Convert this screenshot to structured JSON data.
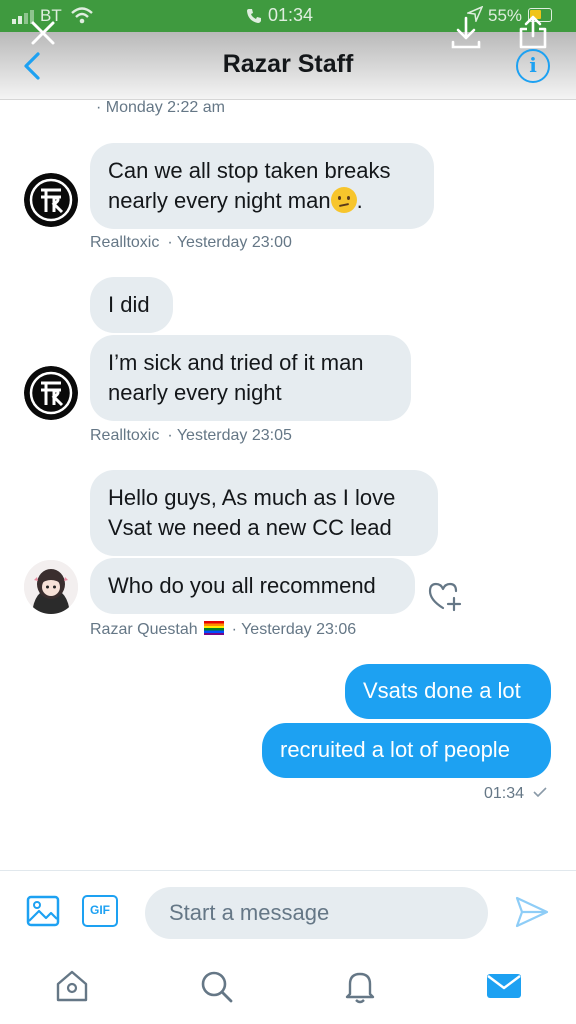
{
  "status_bar": {
    "carrier": "BT",
    "time": "01:34",
    "battery": "55%"
  },
  "header": {
    "title": "Razar Staff"
  },
  "top_timestamp": "· Monday 2:22 am",
  "messages": [
    {
      "sender": "Realltoxic",
      "time": "· Yesterday 23:00",
      "bubbles": [
        "Can we all stop taken breaks nearly every night man",
        "."
      ]
    },
    {
      "sender": "Realltoxic",
      "time": "· Yesterday 23:05",
      "bubbles": [
        "I did",
        "I’m sick and tried of it man nearly every night"
      ]
    },
    {
      "sender": "Razar Questah",
      "time": "· Yesterday 23:06",
      "bubbles": [
        "Hello guys, As much as I love Vsat we need a new CC lead",
        "Who do you all recommend"
      ]
    },
    {
      "sender": "me",
      "time": "01:34",
      "bubbles": [
        "Vsats done a lot",
        "recruited a lot of people"
      ]
    }
  ],
  "composer": {
    "placeholder": "Start a message",
    "gif_label": "GIF"
  },
  "icons": {
    "back": "chevron-left-icon",
    "info": "info-icon",
    "close": "close-icon",
    "download": "download-icon",
    "share": "share-icon",
    "react": "heart-add-icon",
    "image": "image-icon",
    "send": "send-icon",
    "tabs": [
      "home-icon",
      "search-icon",
      "bell-icon",
      "mail-icon"
    ]
  },
  "colors": {
    "accent": "#1da1f2",
    "status_banner": "#3f9a3f",
    "incoming_bubble": "#e6ecf0",
    "muted_text": "#657786"
  }
}
